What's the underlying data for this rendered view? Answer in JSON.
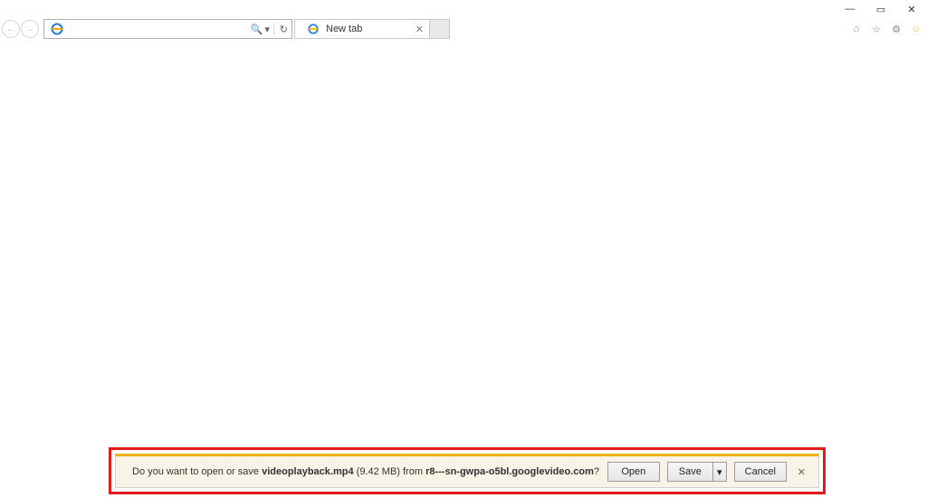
{
  "window": {
    "minimize_glyph": "—",
    "maximize_glyph": "▭",
    "close_glyph": "✕"
  },
  "toolbar": {
    "back_glyph": "←",
    "forward_glyph": "→",
    "address_value": "",
    "search_glyph": "🔍",
    "dropdown_glyph": "▾",
    "refresh_glyph": "↻"
  },
  "tab": {
    "title": "New tab",
    "close_glyph": "✕"
  },
  "chrome": {
    "home_glyph": "⌂",
    "fav_glyph": "☆",
    "tools_glyph": "⚙",
    "feedback_glyph": "☺"
  },
  "download": {
    "prefix": "Do you want to open or save ",
    "filename": "videoplayback.mp4",
    "size": " (9.42 MB) ",
    "from_word": "from ",
    "host": "r8---sn-gwpa-o5bl.googlevideo.com",
    "suffix": "?",
    "open_label": "Open",
    "save_label": "Save",
    "save_arrow": "▾",
    "cancel_label": "Cancel",
    "close_glyph": "✕"
  }
}
